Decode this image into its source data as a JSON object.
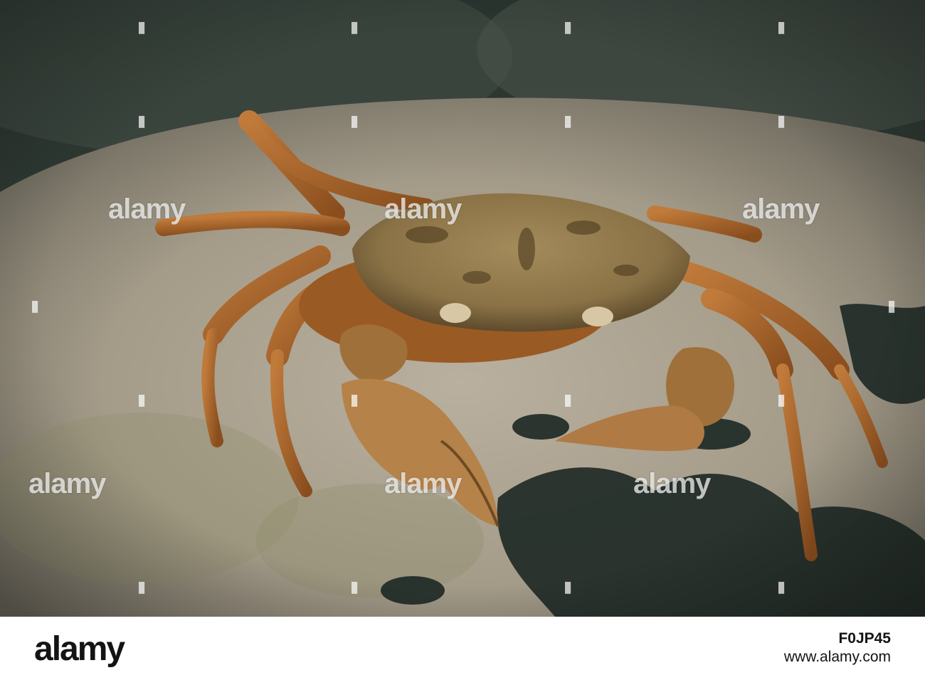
{
  "photo": {
    "subject": "crab on rock"
  },
  "watermark": {
    "text": "alamy"
  },
  "footer": {
    "logo": "alamy",
    "image_id": "F0JP45",
    "url": "www.alamy.com"
  }
}
